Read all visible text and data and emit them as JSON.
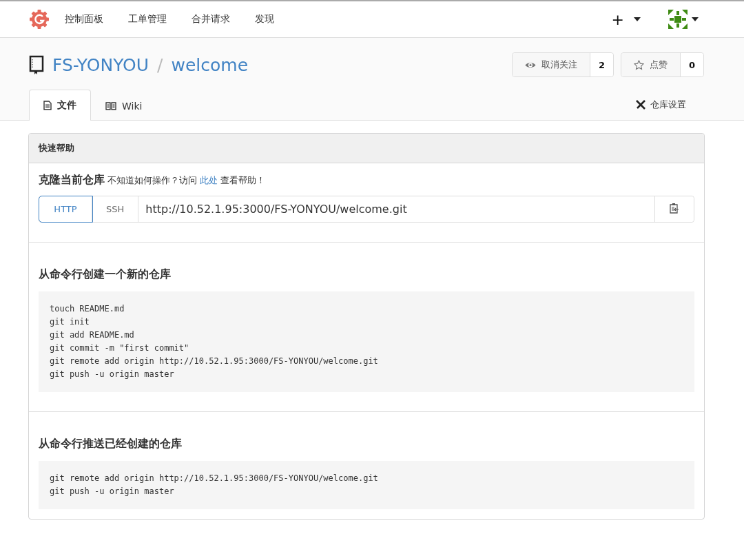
{
  "nav": {
    "items": [
      "控制面板",
      "工单管理",
      "合并请求",
      "发现"
    ],
    "plus": "+"
  },
  "repo": {
    "owner": "FS-YONYOU",
    "separator": "/",
    "name": "welcome",
    "buttons": [
      {
        "kind": "watch",
        "label": "取消关注",
        "count": "2"
      },
      {
        "kind": "star",
        "label": "点赞",
        "count": "0"
      }
    ]
  },
  "tabs": [
    {
      "kind": "files",
      "label": "文件",
      "selected": true
    },
    {
      "kind": "wiki",
      "label": "Wiki",
      "selected": false
    }
  ],
  "settings": "仓库设置",
  "panel": {
    "title": "快速帮助",
    "clone": {
      "title": "克隆当前仓库",
      "hint_before": "不知道如何操作？访问 ",
      "link": "此处",
      "hint_after": " 查看帮助！",
      "protocols": [
        {
          "label": "HTTP",
          "selected": true
        },
        {
          "label": "SSH",
          "selected": false
        }
      ],
      "url": "http://10.52.1.95:3000/FS-YONYOU/welcome.git"
    },
    "sections": [
      {
        "title": "从命令行创建一个新的仓库",
        "code": [
          "touch README.md",
          "git init",
          "git add README.md",
          "git commit -m \"first commit\"",
          "git remote add origin http://10.52.1.95:3000/FS-YONYOU/welcome.git",
          "git push -u origin master"
        ]
      },
      {
        "title": "从命令行推送已经创建的仓库",
        "code": [
          "git remote add origin http://10.52.1.95:3000/FS-YONYOU/welcome.git",
          "git push -u origin master"
        ]
      }
    ]
  }
}
